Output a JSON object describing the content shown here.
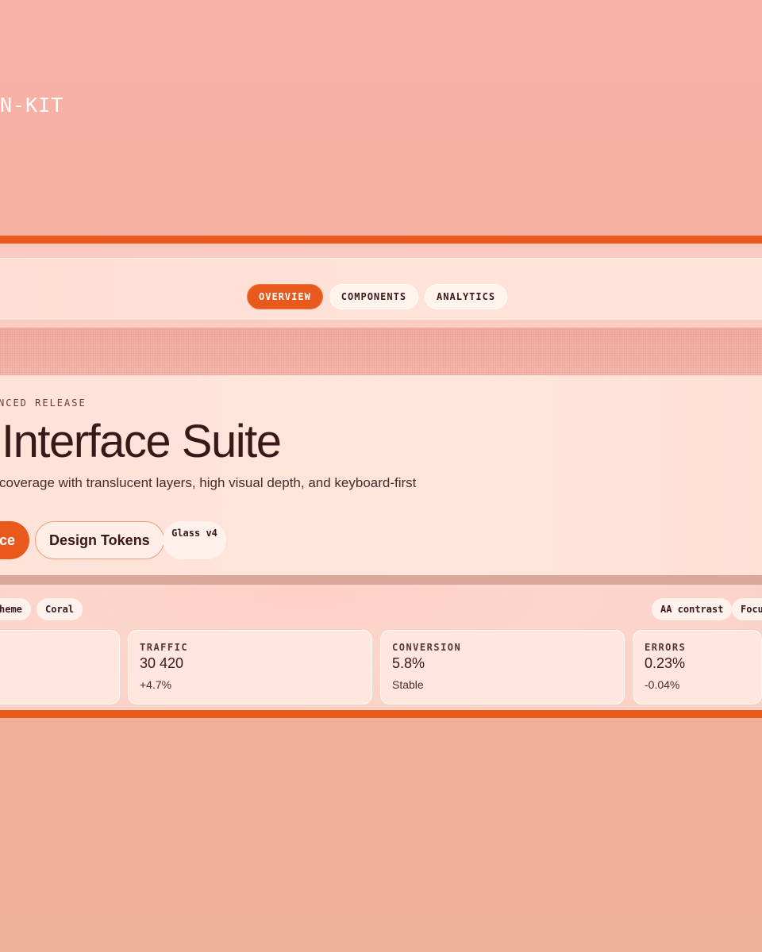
{
  "brand": {
    "text": "N-KIT"
  },
  "nav": {
    "tabs": [
      {
        "label": "OVERVIEW",
        "active": true
      },
      {
        "label": "COMPONENTS",
        "active": false
      },
      {
        "label": "ANALYTICS",
        "active": false
      }
    ]
  },
  "hero": {
    "eyebrow": "NCED RELEASE",
    "title": "Interface Suite",
    "description": "coverage with translucent layers, high visual depth, and keyboard-first",
    "primary_cta": "ce",
    "secondary_cta": "Design Tokens",
    "badge": "Glass v4"
  },
  "chips_left": [
    "heme",
    "Coral"
  ],
  "chips_right": [
    "AA contrast",
    "Focu"
  ],
  "metrics": [
    {
      "label": "TRAFFIC",
      "value": "30 420",
      "delta": "+4.7%"
    },
    {
      "label": "CONVERSION",
      "value": "5.8%",
      "delta": "Stable"
    },
    {
      "label": "ERRORS",
      "value": "0.23%",
      "delta": "-0.04%"
    }
  ],
  "colors": {
    "accent": "#e8591b",
    "text": "#3b1818",
    "background_top": "#f9b2a8",
    "background_bottom": "#edb29a"
  }
}
